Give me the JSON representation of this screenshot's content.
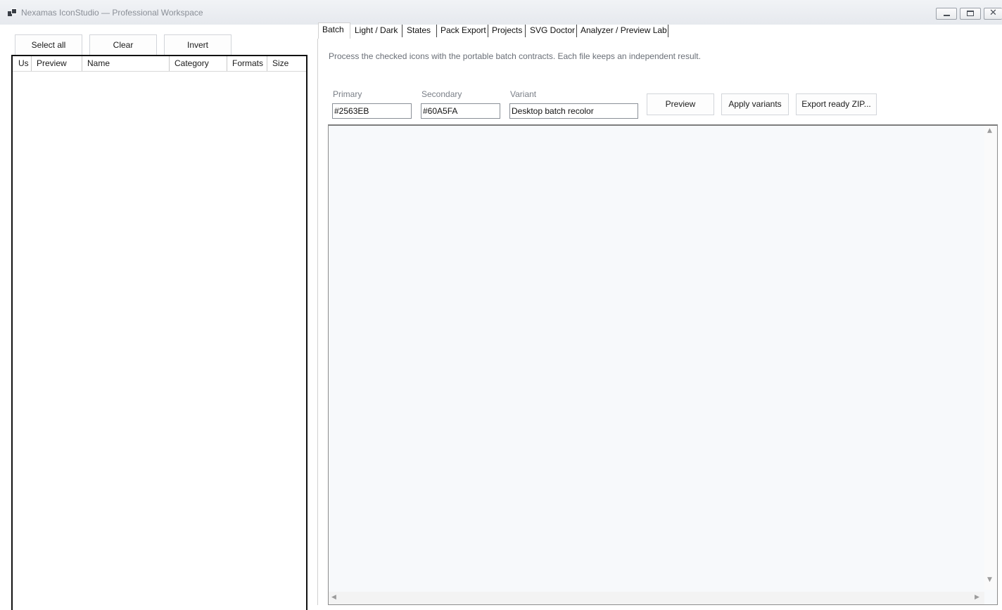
{
  "window": {
    "title": "Nexamas IconStudio — Professional Workspace",
    "close_glyph": "✕"
  },
  "left_panel": {
    "select_all_label": "Select all",
    "clear_label": "Clear",
    "invert_label": "Invert",
    "columns": [
      "Us",
      "Preview",
      "Name",
      "Category",
      "Formats",
      "Size"
    ]
  },
  "tabs": [
    "Batch",
    "Light / Dark",
    "States",
    "Pack Export",
    "Projects",
    "SVG Doctor",
    "Analyzer / Preview Lab"
  ],
  "active_tab": "Batch",
  "batch": {
    "description": "Process the checked icons with the portable batch contracts. Each file keeps an independent result.",
    "primary_label": "Primary",
    "primary_value": "#2563EB",
    "secondary_label": "Secondary",
    "secondary_value": "#60A5FA",
    "variant_label": "Variant",
    "variant_value": "Desktop batch recolor",
    "preview_label": "Preview",
    "apply_label": "Apply variants",
    "export_label": "Export ready ZIP..."
  },
  "scroll": {
    "up": "▲",
    "down": "▼",
    "left": "◀",
    "right": "▶"
  }
}
